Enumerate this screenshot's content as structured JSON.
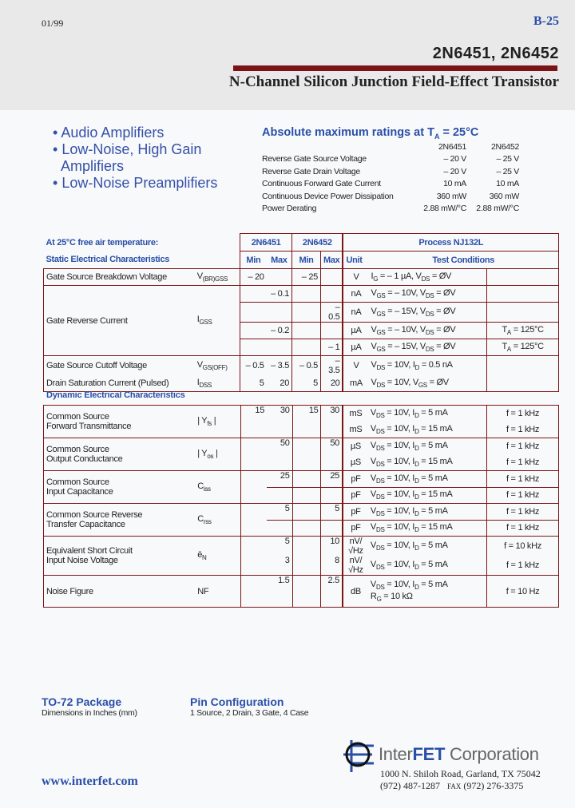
{
  "header": {
    "date": "01/99",
    "page_number": "B-25",
    "part_numbers": "2N6451, 2N6452",
    "subtitle": "N-Channel Silicon Junction Field-Effect Transistor"
  },
  "features": [
    "Audio Amplifiers",
    "Low-Noise, High Gain",
    "Amplifiers",
    "Low-Noise Preamplifiers"
  ],
  "abs_max": {
    "title_pre": "Absolute maximum ratings at T",
    "title_sub": "A",
    "title_post": " = 25°C",
    "cols": [
      "2N6451",
      "2N6452"
    ],
    "rows": [
      {
        "label": "Reverse Gate Source Voltage",
        "a": "– 20 V",
        "b": "– 25 V"
      },
      {
        "label": "Reverse Gate Drain Voltage",
        "a": "– 20 V",
        "b": "– 25 V"
      },
      {
        "label": "Continuous Forward Gate Current",
        "a": "10 mA",
        "b": "10 mA"
      },
      {
        "label": "Continuous Device Power Dissipation",
        "a": "360 mW",
        "b": "360 mW"
      },
      {
        "label": "Power Derating",
        "a": "2.88 mW/°C",
        "b": "2.88 mW/°C"
      }
    ]
  },
  "static": {
    "temp_note": "At 25°C free air temperature:",
    "title": "Static Electrical Characteristics",
    "col_2n6451": "2N6451",
    "col_2n6452": "2N6452",
    "process": "Process NJ132L",
    "min": "Min",
    "max": "Max",
    "unit": "Unit",
    "test_conditions": "Test Conditions",
    "rows": [
      {
        "param": "Gate Source Breakdown Voltage",
        "sym": "V",
        "sym_sub": "(BR)GSS",
        "min1": "– 20",
        "max1": "",
        "min2": "– 25",
        "max2": "",
        "unit": "V",
        "cond": "I_G = – 1 µA, V_DS = ØV",
        "extra": ""
      },
      {
        "param": "Gate Reverse Current",
        "sym": "I",
        "sym_sub": "GSS",
        "min1": "",
        "max1": "– 0.1",
        "min2": "",
        "max2": "",
        "unit": "nA",
        "cond": "V_GS = – 10V, V_DS = ØV",
        "extra": ""
      },
      {
        "param": "",
        "min1": "",
        "max1": "",
        "min2": "",
        "max2": "– 0.5",
        "unit": "nA",
        "cond": "V_GS = – 15V, V_DS = ØV",
        "extra": ""
      },
      {
        "param": "",
        "min1": "",
        "max1": "– 0.2",
        "min2": "",
        "max2": "",
        "unit": "µA",
        "cond": "V_GS = – 10V, V_DS = ØV",
        "extra": "T_A = 125°C"
      },
      {
        "param": "",
        "min1": "",
        "max1": "",
        "min2": "",
        "max2": "– 1",
        "unit": "µA",
        "cond": "V_GS = – 15V, V_DS = ØV",
        "extra": "T_A = 125°C"
      },
      {
        "param": "Gate Source Cutoff Voltage",
        "sym": "V",
        "sym_sub": "GS(OFF)",
        "min1": "– 0.5",
        "max1": "– 3.5",
        "min2": "– 0.5",
        "max2": "– 3.5",
        "unit": "V",
        "cond": "V_DS = 10V, I_D = 0.5 nA",
        "extra": ""
      },
      {
        "param": "Drain Saturation Current (Pulsed)",
        "sym": "I",
        "sym_sub": "DSS",
        "min1": "5",
        "max1": "20",
        "min2": "5",
        "max2": "20",
        "unit": "mA",
        "cond": "V_DS = 10V, V_GS = ØV",
        "extra": ""
      }
    ]
  },
  "dynamic": {
    "title": "Dynamic Electrical Characteristics",
    "groups": [
      {
        "param1": "Common Source",
        "param2": "Forward Transmittance",
        "sym": "| Y",
        "sym_sub": "fs",
        "sym_post": " |",
        "rows": [
          {
            "min1": "15",
            "max1": "30",
            "min2": "15",
            "max2": "30",
            "unit": "mS",
            "cond": "V_DS = 10V, I_D = 5 mA",
            "extra": "f = 1 kHz"
          },
          {
            "min1": "",
            "max1": "",
            "min2": "",
            "max2": "",
            "unit": "mS",
            "cond": "V_DS = 10V, I_D = 15 mA",
            "extra": "f = 1 kHz"
          }
        ]
      },
      {
        "param1": "Common Source",
        "param2": "Output Conductance",
        "sym": "| Y",
        "sym_sub": "os",
        "sym_post": " |",
        "rows": [
          {
            "min1": "",
            "max1": "50",
            "min2": "",
            "max2": "50",
            "unit": "µS",
            "cond": "V_DS = 10V, I_D = 5 mA",
            "extra": "f = 1 kHz"
          },
          {
            "min1": "",
            "max1": "",
            "min2": "",
            "max2": "",
            "unit": "µS",
            "cond": "V_DS = 10V, I_D = 15 mA",
            "extra": "f = 1 kHz"
          }
        ]
      },
      {
        "param1": "Common Source",
        "param2": "Input Capacitance",
        "sym": "C",
        "sym_sub": "iss",
        "sym_post": "",
        "rows": [
          {
            "min1": "",
            "max1": "25",
            "min2": "",
            "max2": "25",
            "unit": "pF",
            "cond": "V_DS = 10V, I_D = 5 mA",
            "extra": "f = 1 kHz"
          },
          {
            "min1": "",
            "max1": "",
            "min2": "",
            "max2": "",
            "unit": "pF",
            "cond": "V_DS = 10V, I_D = 15 mA",
            "extra": "f = 1 kHz"
          }
        ]
      },
      {
        "param1": "Common Source Reverse",
        "param2": "Transfer Capacitance",
        "sym": "C",
        "sym_sub": "rss",
        "sym_post": "",
        "rows": [
          {
            "min1": "",
            "max1": "5",
            "min2": "",
            "max2": "5",
            "unit": "pF",
            "cond": "V_DS = 10V, I_D = 5 mA",
            "extra": "f = 1 kHz"
          },
          {
            "min1": "",
            "max1": "",
            "min2": "",
            "max2": "",
            "unit": "pF",
            "cond": "V_DS = 10V, I_D = 15 mA",
            "extra": "f = 1 kHz"
          }
        ]
      },
      {
        "param1": "Equivalent Short Circuit",
        "param2": "Input Noise Voltage",
        "sym": "ē",
        "sym_sub": "N",
        "sym_post": "",
        "rows": [
          {
            "min1": "",
            "max1": "5",
            "min2": "",
            "max2": "10",
            "unit": "nV/√Hz",
            "cond": "V_DS = 10V, I_D = 5 mA",
            "extra": "f = 10 kHz"
          },
          {
            "min1": "",
            "max1": "3",
            "min2": "",
            "max2": "8",
            "unit": "nV/√Hz",
            "cond": "V_DS = 10V, I_D = 5 mA",
            "extra": "f = 1 kHz"
          }
        ]
      },
      {
        "param1": "Noise Figure",
        "param2": "",
        "sym": "NF",
        "sym_sub": "",
        "sym_post": "",
        "rows": [
          {
            "min1": "",
            "max1": "1.5",
            "min2": "",
            "max2": "2.5",
            "unit": "dB",
            "cond": "V_DS = 10V, I_D = 5 mA",
            "cond2": "R_G = 10 kΩ",
            "extra": "f = 10 Hz"
          }
        ]
      }
    ]
  },
  "footer": {
    "package_title": "TO-72 Package",
    "package_sub": "Dimensions in Inches (mm)",
    "pin_title": "Pin Configuration",
    "pin_sub": "1 Source, 2 Drain, 3 Gate, 4 Case",
    "url": "www.interfet.com",
    "corp_pre": "Inter",
    "corp_bold": "FET",
    "corp_post": " Corporation",
    "address": "1000 N. Shiloh Road, Garland, TX 75042",
    "phone": "(972) 487-1287",
    "fax_label": "FAX",
    "fax": "(972) 276-3375"
  },
  "colors": {
    "accent_blue": "#2a4fa8",
    "rule_red": "#7a1416",
    "header_gray": "#e9e9e9"
  }
}
